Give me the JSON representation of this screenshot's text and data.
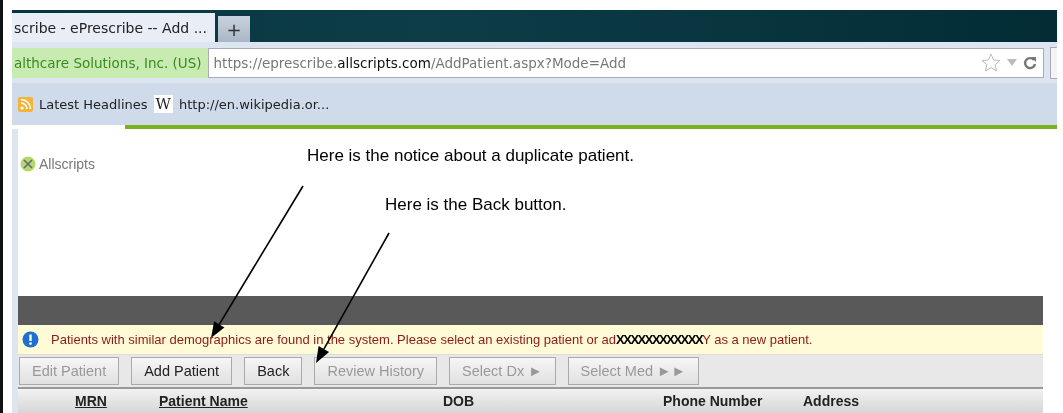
{
  "browser": {
    "tab": {
      "title": "scribe - ePrescribe -- Add ...",
      "selected": true
    },
    "new_tab": "+",
    "identity": "althcare Solutions, Inc. (US)",
    "url": {
      "prefix": "https://eprescribe.",
      "domain": "allscripts.com",
      "path": "/AddPatient.aspx?Mode=Add"
    },
    "bookmarks": [
      {
        "label": "Latest Headlines",
        "kind": "feed"
      },
      {
        "label": "http://en.wikipedia.or...",
        "kind": "wiki",
        "icon": "W"
      }
    ]
  },
  "logo": "Allscripts",
  "annotations": [
    {
      "text": "Here is the notice about a duplicate patient."
    },
    {
      "text": "Here is the Back button."
    }
  ],
  "notice": {
    "message": "Patients with similar demographics are found in the system. Please select an existing patient or ad**XXXXXXXXXXXX**Y as a new patient."
  },
  "buttons": [
    {
      "label": "Edit Patient",
      "disabled": true
    },
    {
      "label": "Add Patient",
      "disabled": false
    },
    {
      "label": "Back",
      "disabled": false
    },
    {
      "label": "Review History",
      "disabled": true
    },
    {
      "label": "Select Dx ►",
      "disabled": true
    },
    {
      "label": "Select Med ►►",
      "disabled": true
    }
  ],
  "table": {
    "columns": [
      {
        "label": "MRN",
        "sortable": true
      },
      {
        "label": "Patient Name",
        "sortable": true
      },
      {
        "label": "DOB",
        "sortable": false
      },
      {
        "label": "Phone Number",
        "sortable": false
      },
      {
        "label": "Address",
        "sortable": false
      }
    ]
  }
}
